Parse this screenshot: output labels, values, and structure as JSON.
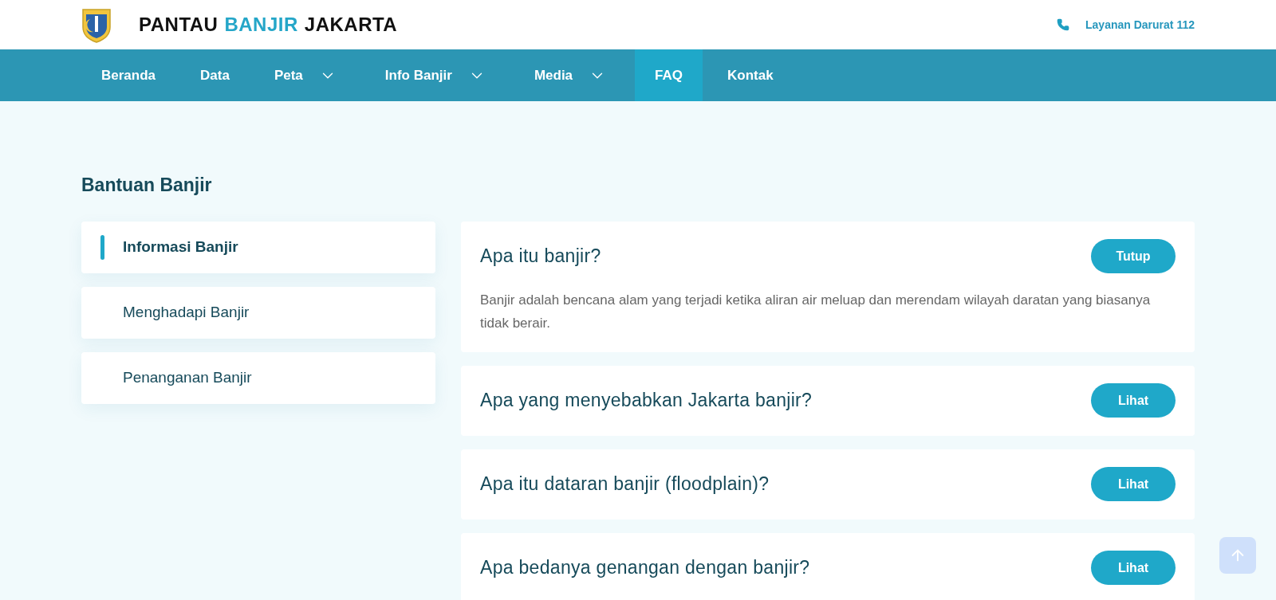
{
  "header": {
    "brand_parts": [
      {
        "text": "PANTAU",
        "kind": "dark"
      },
      {
        "text": "BANJIR",
        "kind": "accent"
      },
      {
        "text": "JAKARTA",
        "kind": "dark"
      }
    ],
    "emergency": "Layanan Darurat 112"
  },
  "nav": [
    {
      "label": "Beranda",
      "dropdown": false,
      "selected": false
    },
    {
      "label": "Data",
      "dropdown": false,
      "selected": false
    },
    {
      "label": "Peta",
      "dropdown": true,
      "selected": false
    },
    {
      "label": "Info Banjir",
      "dropdown": true,
      "selected": false
    },
    {
      "label": "Media",
      "dropdown": true,
      "selected": false
    },
    {
      "label": "FAQ",
      "dropdown": false,
      "selected": true
    },
    {
      "label": "Kontak",
      "dropdown": false,
      "selected": false
    }
  ],
  "page_title": "Bantuan Banjir",
  "sidebar": [
    {
      "label": "Informasi Banjir",
      "selected": true
    },
    {
      "label": "Menghadapi Banjir",
      "selected": false
    },
    {
      "label": "Penanganan Banjir",
      "selected": false
    }
  ],
  "faq": [
    {
      "question": "Apa itu banjir?",
      "button": "Tutup",
      "expanded": true,
      "answer": "Banjir adalah bencana alam yang terjadi ketika aliran air meluap dan merendam wilayah daratan yang biasanya tidak berair."
    },
    {
      "question": "Apa yang menyebabkan Jakarta banjir?",
      "button": "Lihat",
      "expanded": false
    },
    {
      "question": "Apa itu dataran banjir (floodplain)?",
      "button": "Lihat",
      "expanded": false
    },
    {
      "question": "Apa bedanya genangan dengan banjir?",
      "button": "Lihat",
      "expanded": false
    }
  ]
}
